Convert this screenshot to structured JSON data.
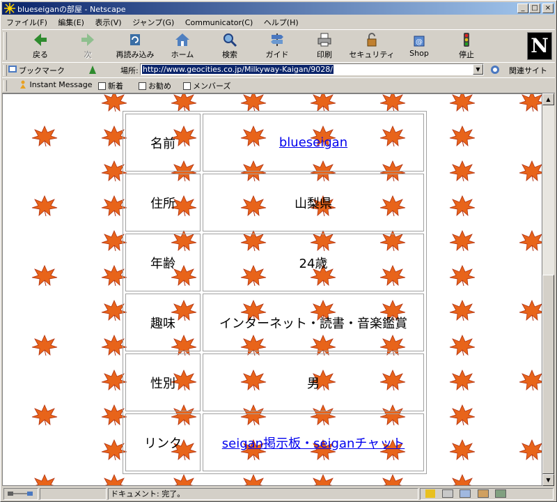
{
  "window": {
    "title": "blueseiganの部屋 - Netscape"
  },
  "menu": [
    "ファイル(F)",
    "編集(E)",
    "表示(V)",
    "ジャンプ(G)",
    "Communicator(C)",
    "ヘルプ(H)"
  ],
  "toolbar": {
    "back": "戻る",
    "forward": "次",
    "reload": "再読み込み",
    "home": "ホーム",
    "search": "検索",
    "guide": "ガイド",
    "print": "印刷",
    "security": "セキュリティ",
    "shop": "Shop",
    "stop": "停止",
    "logo": "N"
  },
  "location": {
    "bookmarks": "ブックマーク",
    "label": "場所:",
    "url": "http://www.geocities.co.jp/Milkyway-Kaigan/9028/",
    "related": "関連サイト"
  },
  "personal": [
    "Instant Message",
    "新着",
    "お勧め",
    "メンバーズ"
  ],
  "profile": {
    "rows": [
      {
        "label": "名前",
        "value": "blueseigan",
        "link": true
      },
      {
        "label": "住所",
        "value": "山梨県"
      },
      {
        "label": "年齢",
        "value": "24歳"
      },
      {
        "label": "趣味",
        "value": "インターネット・読書・音楽鑑賞"
      },
      {
        "label": "性別",
        "value": "男"
      },
      {
        "label": "リンク",
        "value": "seigan掲示板・seiganチャット",
        "link": true
      }
    ]
  },
  "status": {
    "text": "ドキュメント: 完了。"
  },
  "colors": {
    "titlebar": "#0a246a",
    "link": "#0000ee",
    "leaf": "#e8641a"
  }
}
